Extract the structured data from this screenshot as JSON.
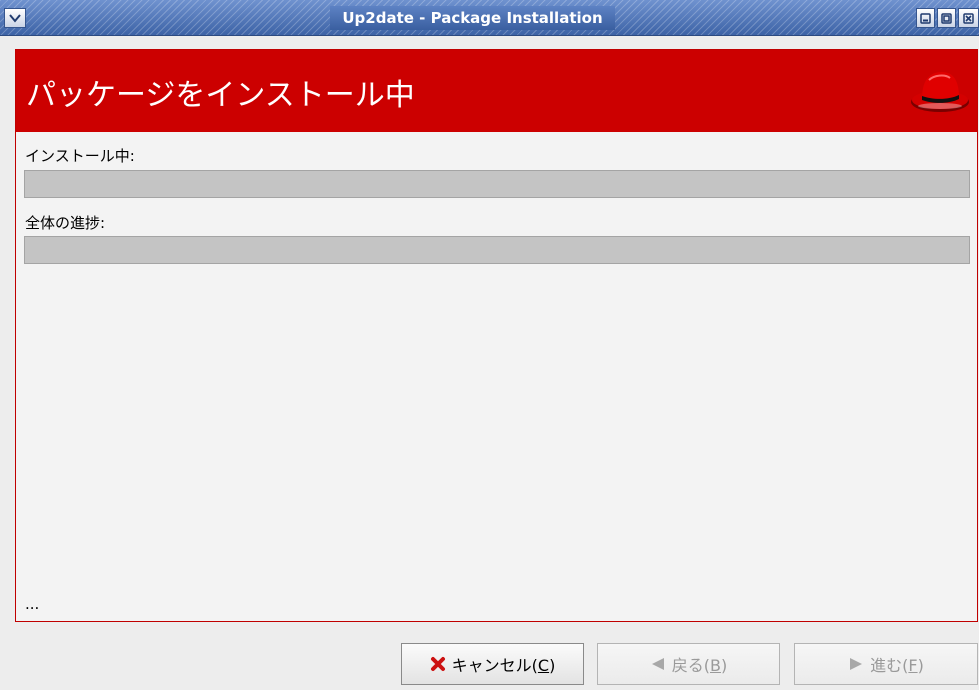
{
  "window": {
    "title": "Up2date - Package Installation",
    "icons": [
      "window-menu-icon",
      "minimize-icon",
      "maximize-icon",
      "close-icon"
    ]
  },
  "banner": {
    "title": "パッケージをインストール中",
    "logo_icon": "redhat-logo-icon",
    "color": "#cc0000"
  },
  "progress": {
    "installing_label": "インストール中:",
    "installing_value": 0,
    "overall_label": "全体の進捗:",
    "overall_value": 0
  },
  "status_text": "...",
  "buttons": {
    "cancel": {
      "text": "キャンセル(",
      "key": "C",
      "suffix": ")",
      "icon": "cancel-x-icon",
      "enabled": true
    },
    "back": {
      "text": "戻る(",
      "key": "B",
      "suffix": ")",
      "icon": "back-arrow-icon",
      "enabled": false
    },
    "forward": {
      "text": "進む(",
      "key": "F",
      "suffix": ")",
      "icon": "forward-arrow-icon",
      "enabled": false
    }
  }
}
